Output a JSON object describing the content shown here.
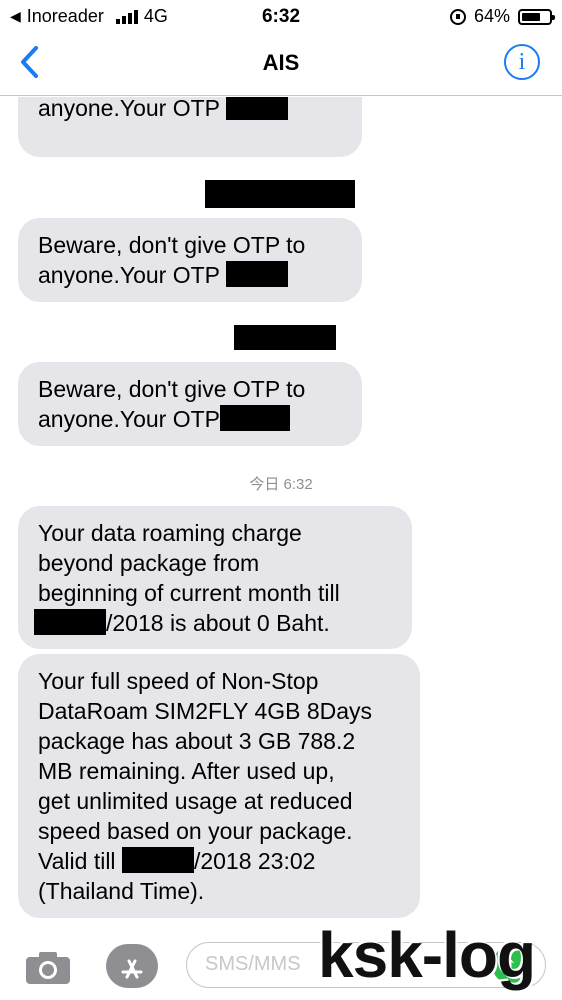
{
  "status_bar": {
    "back_app": "Inoreader",
    "network": "4G",
    "time": "6:32",
    "battery": "64%"
  },
  "nav": {
    "title": "AIS",
    "info_icon": "i"
  },
  "messages": {
    "otp_line1": "Beware, don't give OTP to",
    "otp_line2": "anyone.Your OTP",
    "timestamp": "今日 6:32",
    "roaming": {
      "line1": "Your data roaming charge",
      "line2": "beyond package from",
      "line3": "beginning of current month till",
      "line4_suffix": "/2018 is about 0 Baht."
    },
    "fullspeed": {
      "line1": "Your full speed of Non-Stop",
      "line2": "DataRoam SIM2FLY 4GB 8Days",
      "line3": "package has about 3 GB 788.2",
      "line4": "MB remaining. After used up,",
      "line5": "get unlimited usage at reduced",
      "line6": "speed based on your package.",
      "line7_prefix": "Valid till",
      "line7_suffix": "/2018 23:02",
      "line8": "(Thailand Time)."
    }
  },
  "composer": {
    "placeholder": "SMS/MMS"
  },
  "watermark": "ksk-log",
  "colors": {
    "accent": "#1a7cf4",
    "bubble": "#e5e5ea",
    "send": "#2fbf4f"
  }
}
